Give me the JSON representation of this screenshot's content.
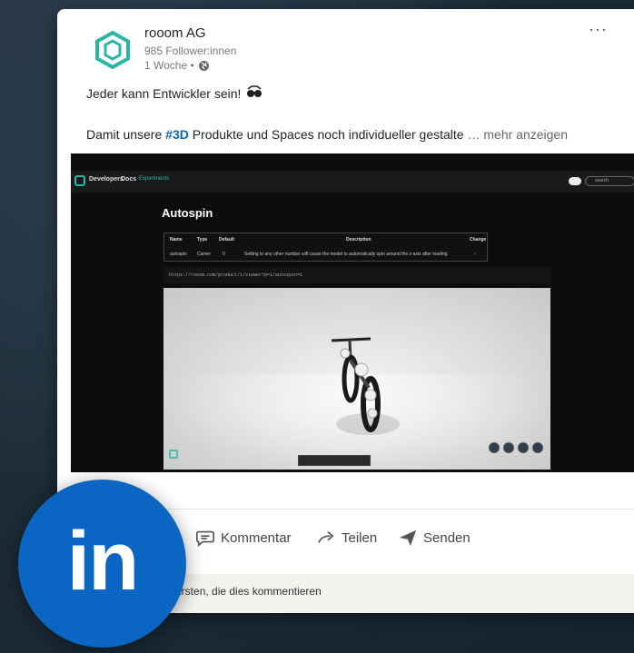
{
  "post": {
    "company": "rooom AG",
    "followers": "985 Follower:innen",
    "time": "1 Woche •",
    "text_line1": "Jeder kann Entwickler sein!",
    "text_line2_before": "Damit unsere ",
    "hashtag": "#3D",
    "text_line2_after": " Produkte und Spaces noch individueller gestalte",
    "see_more": "… mehr anzeigen",
    "more_menu": "···"
  },
  "media": {
    "brand": "Developers",
    "docs": "Docs",
    "experiments": "Experiments",
    "search": "search",
    "title": "Autospin",
    "table": {
      "headers": [
        "Name",
        "Type",
        "Default",
        "Description",
        "Change"
      ],
      "row": [
        "autospin",
        "Camer",
        "0",
        "Setting to any other number will cause the model to automatically spin around the z-axis after loading.",
        "✓"
      ]
    },
    "code": "https://rooom.com/product/1/viewer?p=1/autospin=1"
  },
  "actions": {
    "comment": "Kommentar",
    "share": "Teilen",
    "send": "Senden"
  },
  "comment_prompt": "en Ersten, die dies kommentieren",
  "badge": "in",
  "colors": {
    "linkedin_blue": "#0a66c2",
    "brand_teal": "#2bb4a8",
    "background": "#1b2a36"
  },
  "icons": [
    "rooom-logo-icon",
    "globe-icon",
    "glasses-emoji-icon",
    "comment-icon",
    "share-icon",
    "send-icon",
    "linkedin-badge-icon"
  ]
}
